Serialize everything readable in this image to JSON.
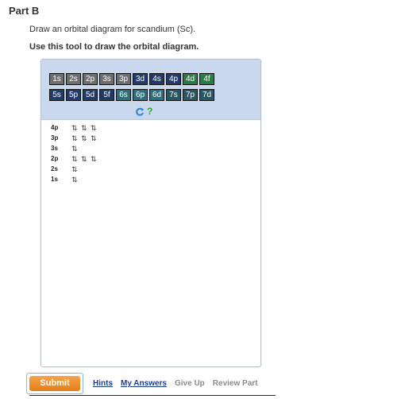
{
  "part_title": "Part B",
  "instruction": "Draw an orbital diagram for scandium (Sc).",
  "tool_instruction": "Use this tool to draw the orbital diagram.",
  "orbital_buttons_row1": [
    "1s",
    "2s",
    "2p",
    "3s",
    "3p",
    "3d",
    "4s",
    "4p",
    "4d",
    "4f"
  ],
  "orbital_buttons_row2": [
    "5s",
    "5p",
    "5d",
    "5f",
    "6s",
    "6p",
    "6d",
    "7s",
    "7p",
    "7d"
  ],
  "diagram": [
    {
      "label": "4p",
      "boxes": [
        "up-down",
        "up-down",
        "up-down"
      ]
    },
    {
      "label": "3p",
      "boxes": [
        "up-down",
        "up-down",
        "up-down"
      ]
    },
    {
      "label": "3s",
      "boxes": [
        "up-down"
      ]
    },
    {
      "label": "2p",
      "boxes": [
        "up-down",
        "up-down",
        "up-down"
      ]
    },
    {
      "label": "2s",
      "boxes": [
        "up-down"
      ]
    },
    {
      "label": "1s",
      "boxes": [
        "up-down"
      ]
    }
  ],
  "submit_label": "Submit",
  "links": {
    "hints": "Hints",
    "my_answers": "My Answers",
    "give_up": "Give Up",
    "review_part": "Review Part"
  },
  "colors": {
    "accent_orange": "#e67c16",
    "header_blue": "#c9d8ed",
    "link_blue": "#1a3f8a"
  }
}
